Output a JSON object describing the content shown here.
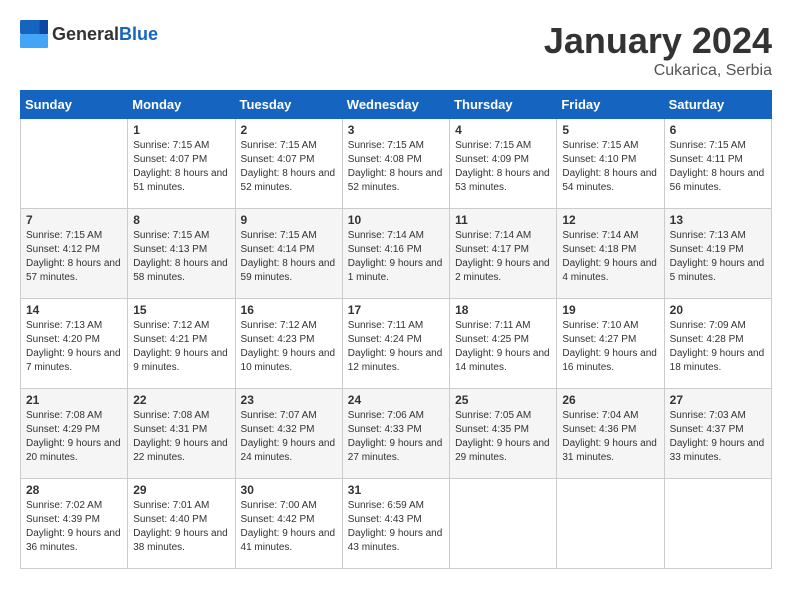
{
  "header": {
    "logo_general": "General",
    "logo_blue": "Blue",
    "month": "January 2024",
    "location": "Cukarica, Serbia"
  },
  "weekdays": [
    "Sunday",
    "Monday",
    "Tuesday",
    "Wednesday",
    "Thursday",
    "Friday",
    "Saturday"
  ],
  "weeks": [
    [
      {
        "day": "",
        "sunrise": "",
        "sunset": "",
        "daylight": ""
      },
      {
        "day": "1",
        "sunrise": "Sunrise: 7:15 AM",
        "sunset": "Sunset: 4:07 PM",
        "daylight": "Daylight: 8 hours and 51 minutes."
      },
      {
        "day": "2",
        "sunrise": "Sunrise: 7:15 AM",
        "sunset": "Sunset: 4:07 PM",
        "daylight": "Daylight: 8 hours and 52 minutes."
      },
      {
        "day": "3",
        "sunrise": "Sunrise: 7:15 AM",
        "sunset": "Sunset: 4:08 PM",
        "daylight": "Daylight: 8 hours and 52 minutes."
      },
      {
        "day": "4",
        "sunrise": "Sunrise: 7:15 AM",
        "sunset": "Sunset: 4:09 PM",
        "daylight": "Daylight: 8 hours and 53 minutes."
      },
      {
        "day": "5",
        "sunrise": "Sunrise: 7:15 AM",
        "sunset": "Sunset: 4:10 PM",
        "daylight": "Daylight: 8 hours and 54 minutes."
      },
      {
        "day": "6",
        "sunrise": "Sunrise: 7:15 AM",
        "sunset": "Sunset: 4:11 PM",
        "daylight": "Daylight: 8 hours and 56 minutes."
      }
    ],
    [
      {
        "day": "7",
        "sunrise": "Sunrise: 7:15 AM",
        "sunset": "Sunset: 4:12 PM",
        "daylight": "Daylight: 8 hours and 57 minutes."
      },
      {
        "day": "8",
        "sunrise": "Sunrise: 7:15 AM",
        "sunset": "Sunset: 4:13 PM",
        "daylight": "Daylight: 8 hours and 58 minutes."
      },
      {
        "day": "9",
        "sunrise": "Sunrise: 7:15 AM",
        "sunset": "Sunset: 4:14 PM",
        "daylight": "Daylight: 8 hours and 59 minutes."
      },
      {
        "day": "10",
        "sunrise": "Sunrise: 7:14 AM",
        "sunset": "Sunset: 4:16 PM",
        "daylight": "Daylight: 9 hours and 1 minute."
      },
      {
        "day": "11",
        "sunrise": "Sunrise: 7:14 AM",
        "sunset": "Sunset: 4:17 PM",
        "daylight": "Daylight: 9 hours and 2 minutes."
      },
      {
        "day": "12",
        "sunrise": "Sunrise: 7:14 AM",
        "sunset": "Sunset: 4:18 PM",
        "daylight": "Daylight: 9 hours and 4 minutes."
      },
      {
        "day": "13",
        "sunrise": "Sunrise: 7:13 AM",
        "sunset": "Sunset: 4:19 PM",
        "daylight": "Daylight: 9 hours and 5 minutes."
      }
    ],
    [
      {
        "day": "14",
        "sunrise": "Sunrise: 7:13 AM",
        "sunset": "Sunset: 4:20 PM",
        "daylight": "Daylight: 9 hours and 7 minutes."
      },
      {
        "day": "15",
        "sunrise": "Sunrise: 7:12 AM",
        "sunset": "Sunset: 4:21 PM",
        "daylight": "Daylight: 9 hours and 9 minutes."
      },
      {
        "day": "16",
        "sunrise": "Sunrise: 7:12 AM",
        "sunset": "Sunset: 4:23 PM",
        "daylight": "Daylight: 9 hours and 10 minutes."
      },
      {
        "day": "17",
        "sunrise": "Sunrise: 7:11 AM",
        "sunset": "Sunset: 4:24 PM",
        "daylight": "Daylight: 9 hours and 12 minutes."
      },
      {
        "day": "18",
        "sunrise": "Sunrise: 7:11 AM",
        "sunset": "Sunset: 4:25 PM",
        "daylight": "Daylight: 9 hours and 14 minutes."
      },
      {
        "day": "19",
        "sunrise": "Sunrise: 7:10 AM",
        "sunset": "Sunset: 4:27 PM",
        "daylight": "Daylight: 9 hours and 16 minutes."
      },
      {
        "day": "20",
        "sunrise": "Sunrise: 7:09 AM",
        "sunset": "Sunset: 4:28 PM",
        "daylight": "Daylight: 9 hours and 18 minutes."
      }
    ],
    [
      {
        "day": "21",
        "sunrise": "Sunrise: 7:08 AM",
        "sunset": "Sunset: 4:29 PM",
        "daylight": "Daylight: 9 hours and 20 minutes."
      },
      {
        "day": "22",
        "sunrise": "Sunrise: 7:08 AM",
        "sunset": "Sunset: 4:31 PM",
        "daylight": "Daylight: 9 hours and 22 minutes."
      },
      {
        "day": "23",
        "sunrise": "Sunrise: 7:07 AM",
        "sunset": "Sunset: 4:32 PM",
        "daylight": "Daylight: 9 hours and 24 minutes."
      },
      {
        "day": "24",
        "sunrise": "Sunrise: 7:06 AM",
        "sunset": "Sunset: 4:33 PM",
        "daylight": "Daylight: 9 hours and 27 minutes."
      },
      {
        "day": "25",
        "sunrise": "Sunrise: 7:05 AM",
        "sunset": "Sunset: 4:35 PM",
        "daylight": "Daylight: 9 hours and 29 minutes."
      },
      {
        "day": "26",
        "sunrise": "Sunrise: 7:04 AM",
        "sunset": "Sunset: 4:36 PM",
        "daylight": "Daylight: 9 hours and 31 minutes."
      },
      {
        "day": "27",
        "sunrise": "Sunrise: 7:03 AM",
        "sunset": "Sunset: 4:37 PM",
        "daylight": "Daylight: 9 hours and 33 minutes."
      }
    ],
    [
      {
        "day": "28",
        "sunrise": "Sunrise: 7:02 AM",
        "sunset": "Sunset: 4:39 PM",
        "daylight": "Daylight: 9 hours and 36 minutes."
      },
      {
        "day": "29",
        "sunrise": "Sunrise: 7:01 AM",
        "sunset": "Sunset: 4:40 PM",
        "daylight": "Daylight: 9 hours and 38 minutes."
      },
      {
        "day": "30",
        "sunrise": "Sunrise: 7:00 AM",
        "sunset": "Sunset: 4:42 PM",
        "daylight": "Daylight: 9 hours and 41 minutes."
      },
      {
        "day": "31",
        "sunrise": "Sunrise: 6:59 AM",
        "sunset": "Sunset: 4:43 PM",
        "daylight": "Daylight: 9 hours and 43 minutes."
      },
      {
        "day": "",
        "sunrise": "",
        "sunset": "",
        "daylight": ""
      },
      {
        "day": "",
        "sunrise": "",
        "sunset": "",
        "daylight": ""
      },
      {
        "day": "",
        "sunrise": "",
        "sunset": "",
        "daylight": ""
      }
    ]
  ]
}
